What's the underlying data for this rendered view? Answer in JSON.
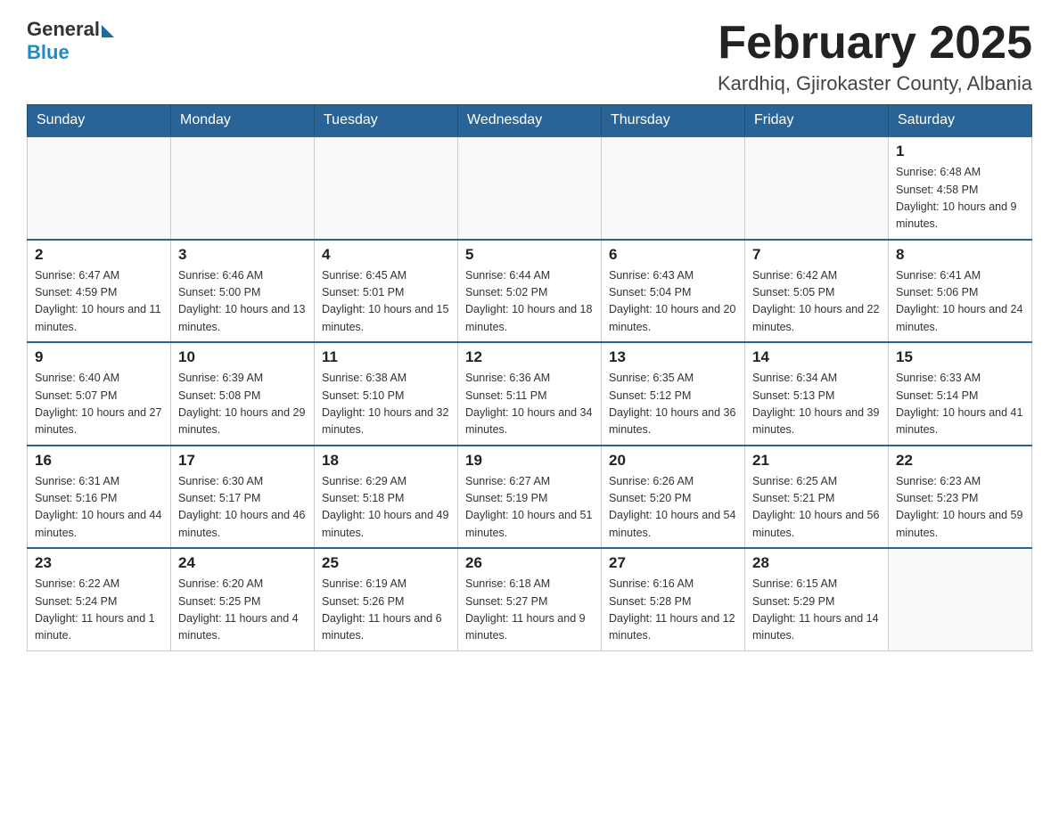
{
  "header": {
    "logo": {
      "general": "General",
      "blue": "Blue"
    },
    "title": "February 2025",
    "subtitle": "Kardhiq, Gjirokaster County, Albania"
  },
  "weekdays": [
    "Sunday",
    "Monday",
    "Tuesday",
    "Wednesday",
    "Thursday",
    "Friday",
    "Saturday"
  ],
  "weeks": [
    [
      {
        "day": "",
        "info": ""
      },
      {
        "day": "",
        "info": ""
      },
      {
        "day": "",
        "info": ""
      },
      {
        "day": "",
        "info": ""
      },
      {
        "day": "",
        "info": ""
      },
      {
        "day": "",
        "info": ""
      },
      {
        "day": "1",
        "info": "Sunrise: 6:48 AM\nSunset: 4:58 PM\nDaylight: 10 hours and 9 minutes."
      }
    ],
    [
      {
        "day": "2",
        "info": "Sunrise: 6:47 AM\nSunset: 4:59 PM\nDaylight: 10 hours and 11 minutes."
      },
      {
        "day": "3",
        "info": "Sunrise: 6:46 AM\nSunset: 5:00 PM\nDaylight: 10 hours and 13 minutes."
      },
      {
        "day": "4",
        "info": "Sunrise: 6:45 AM\nSunset: 5:01 PM\nDaylight: 10 hours and 15 minutes."
      },
      {
        "day": "5",
        "info": "Sunrise: 6:44 AM\nSunset: 5:02 PM\nDaylight: 10 hours and 18 minutes."
      },
      {
        "day": "6",
        "info": "Sunrise: 6:43 AM\nSunset: 5:04 PM\nDaylight: 10 hours and 20 minutes."
      },
      {
        "day": "7",
        "info": "Sunrise: 6:42 AM\nSunset: 5:05 PM\nDaylight: 10 hours and 22 minutes."
      },
      {
        "day": "8",
        "info": "Sunrise: 6:41 AM\nSunset: 5:06 PM\nDaylight: 10 hours and 24 minutes."
      }
    ],
    [
      {
        "day": "9",
        "info": "Sunrise: 6:40 AM\nSunset: 5:07 PM\nDaylight: 10 hours and 27 minutes."
      },
      {
        "day": "10",
        "info": "Sunrise: 6:39 AM\nSunset: 5:08 PM\nDaylight: 10 hours and 29 minutes."
      },
      {
        "day": "11",
        "info": "Sunrise: 6:38 AM\nSunset: 5:10 PM\nDaylight: 10 hours and 32 minutes."
      },
      {
        "day": "12",
        "info": "Sunrise: 6:36 AM\nSunset: 5:11 PM\nDaylight: 10 hours and 34 minutes."
      },
      {
        "day": "13",
        "info": "Sunrise: 6:35 AM\nSunset: 5:12 PM\nDaylight: 10 hours and 36 minutes."
      },
      {
        "day": "14",
        "info": "Sunrise: 6:34 AM\nSunset: 5:13 PM\nDaylight: 10 hours and 39 minutes."
      },
      {
        "day": "15",
        "info": "Sunrise: 6:33 AM\nSunset: 5:14 PM\nDaylight: 10 hours and 41 minutes."
      }
    ],
    [
      {
        "day": "16",
        "info": "Sunrise: 6:31 AM\nSunset: 5:16 PM\nDaylight: 10 hours and 44 minutes."
      },
      {
        "day": "17",
        "info": "Sunrise: 6:30 AM\nSunset: 5:17 PM\nDaylight: 10 hours and 46 minutes."
      },
      {
        "day": "18",
        "info": "Sunrise: 6:29 AM\nSunset: 5:18 PM\nDaylight: 10 hours and 49 minutes."
      },
      {
        "day": "19",
        "info": "Sunrise: 6:27 AM\nSunset: 5:19 PM\nDaylight: 10 hours and 51 minutes."
      },
      {
        "day": "20",
        "info": "Sunrise: 6:26 AM\nSunset: 5:20 PM\nDaylight: 10 hours and 54 minutes."
      },
      {
        "day": "21",
        "info": "Sunrise: 6:25 AM\nSunset: 5:21 PM\nDaylight: 10 hours and 56 minutes."
      },
      {
        "day": "22",
        "info": "Sunrise: 6:23 AM\nSunset: 5:23 PM\nDaylight: 10 hours and 59 minutes."
      }
    ],
    [
      {
        "day": "23",
        "info": "Sunrise: 6:22 AM\nSunset: 5:24 PM\nDaylight: 11 hours and 1 minute."
      },
      {
        "day": "24",
        "info": "Sunrise: 6:20 AM\nSunset: 5:25 PM\nDaylight: 11 hours and 4 minutes."
      },
      {
        "day": "25",
        "info": "Sunrise: 6:19 AM\nSunset: 5:26 PM\nDaylight: 11 hours and 6 minutes."
      },
      {
        "day": "26",
        "info": "Sunrise: 6:18 AM\nSunset: 5:27 PM\nDaylight: 11 hours and 9 minutes."
      },
      {
        "day": "27",
        "info": "Sunrise: 6:16 AM\nSunset: 5:28 PM\nDaylight: 11 hours and 12 minutes."
      },
      {
        "day": "28",
        "info": "Sunrise: 6:15 AM\nSunset: 5:29 PM\nDaylight: 11 hours and 14 minutes."
      },
      {
        "day": "",
        "info": ""
      }
    ]
  ]
}
